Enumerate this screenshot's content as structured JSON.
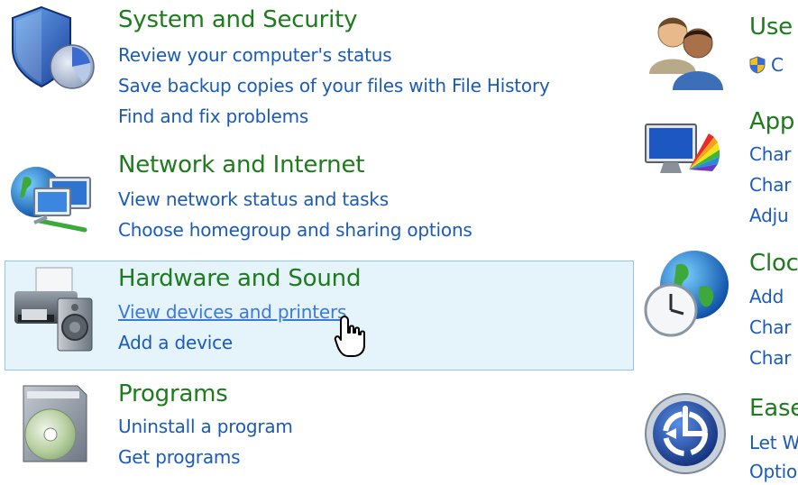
{
  "colors": {
    "title_green": "#1e7b1e",
    "link_blue": "#1a5bb8",
    "hover_bg": "#e5f3fb",
    "hover_border": "#8fc6e9"
  },
  "left": [
    {
      "title": "System and Security",
      "icon": "shield-icon",
      "links": [
        "Review your computer's status",
        "Save backup copies of your files with File History",
        "Find and fix problems"
      ]
    },
    {
      "title": "Network and Internet",
      "icon": "network-globe-icon",
      "links": [
        "View network status and tasks",
        "Choose homegroup and sharing options"
      ]
    },
    {
      "title": "Hardware and Sound",
      "icon": "printer-speaker-icon",
      "links": [
        "View devices and printers",
        "Add a device"
      ]
    },
    {
      "title": "Programs",
      "icon": "programs-disc-icon",
      "links": [
        "Uninstall a program",
        "Get programs"
      ]
    }
  ],
  "right": [
    {
      "title": "Use",
      "icon": "users-icon",
      "links": [
        "C"
      ]
    },
    {
      "title": "App",
      "icon": "appearance-monitor-icon",
      "links": [
        "Char",
        "Char",
        "Adju"
      ]
    },
    {
      "title": "Cloc",
      "icon": "clock-globe-icon",
      "links": [
        "Add",
        "Char",
        "Char"
      ]
    },
    {
      "title": "Ease",
      "icon": "ease-of-access-icon",
      "links": [
        "Let W",
        "Optio"
      ]
    }
  ],
  "hovered_link": "View devices and printers",
  "cursor": "hand-pointer-cursor-icon"
}
